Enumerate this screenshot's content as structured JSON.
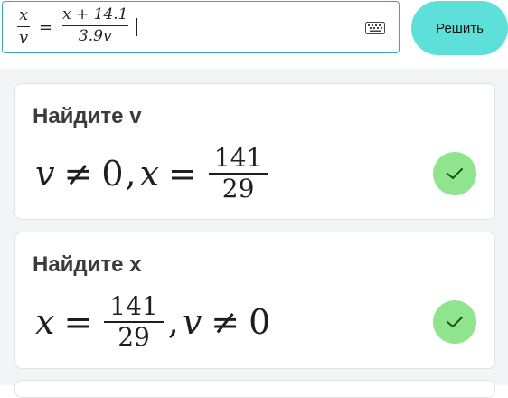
{
  "input": {
    "lhs_numerator": "x",
    "lhs_denominator": "v",
    "equals": "=",
    "rhs_numerator": "x + 14.1",
    "rhs_denominator": "3.9v"
  },
  "toolbar": {
    "solve_label": "Решить",
    "keyboard_icon": "keyboard-icon"
  },
  "results": [
    {
      "title": "Найдите v",
      "answer": {
        "var1": "v",
        "neq": "≠",
        "zero": "0",
        "comma": ",",
        "var2": "x",
        "eq": "=",
        "numerator": "141",
        "denominator": "29"
      },
      "status_icon": "check-icon"
    },
    {
      "title": "Найдите x",
      "answer": {
        "var1": "x",
        "eq": "=",
        "numerator": "141",
        "denominator": "29",
        "comma": ",",
        "var2": "v",
        "neq": "≠",
        "zero": "0"
      },
      "status_icon": "check-icon"
    }
  ],
  "colors": {
    "accent": "#5de0d9",
    "input_border": "#3aa6b9",
    "check_badge": "#8ee58e",
    "background": "#f2f4f5"
  }
}
